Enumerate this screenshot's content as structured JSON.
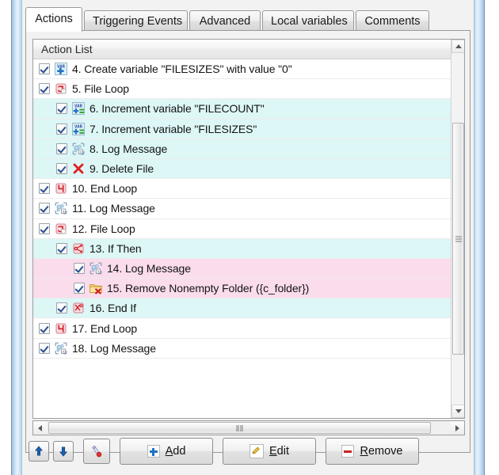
{
  "tabs": [
    {
      "label": "Actions",
      "active": true
    },
    {
      "label": "Triggering Events",
      "active": false
    },
    {
      "label": "Advanced",
      "active": false
    },
    {
      "label": "Local variables",
      "active": false
    },
    {
      "label": "Comments",
      "active": false
    }
  ],
  "list": {
    "header": "Action List",
    "rows": [
      {
        "text": "4. Create variable \"FILESIZES\" with value \"0\"",
        "indent": 0,
        "icon": "var-add-icon",
        "bg": "bg-white",
        "checked": true
      },
      {
        "text": "5. File Loop",
        "indent": 0,
        "icon": "loop-icon",
        "bg": "bg-white",
        "checked": true
      },
      {
        "text": "6. Increment variable \"FILECOUNT\"",
        "indent": 1,
        "icon": "var-increment-icon",
        "bg": "bg-cyan",
        "checked": true
      },
      {
        "text": "7. Increment variable \"FILESIZES\"",
        "indent": 1,
        "icon": "var-increment-icon",
        "bg": "bg-cyan",
        "checked": true
      },
      {
        "text": "8. Log Message",
        "indent": 1,
        "icon": "log-message-icon",
        "bg": "bg-cyan",
        "checked": true
      },
      {
        "text": "9. Delete File",
        "indent": 1,
        "icon": "delete-file-icon",
        "bg": "bg-cyan",
        "checked": true
      },
      {
        "text": "10. End Loop",
        "indent": 0,
        "icon": "end-loop-icon",
        "bg": "bg-white",
        "checked": true
      },
      {
        "text": "11. Log Message",
        "indent": 0,
        "icon": "log-message-icon",
        "bg": "bg-white",
        "checked": true
      },
      {
        "text": "12. File Loop",
        "indent": 0,
        "icon": "loop-icon",
        "bg": "bg-white",
        "checked": true
      },
      {
        "text": "13. If Then",
        "indent": 1,
        "icon": "if-then-icon",
        "bg": "bg-cyan",
        "checked": true
      },
      {
        "text": "14. Log Message",
        "indent": 2,
        "icon": "log-message-icon",
        "bg": "bg-pink",
        "checked": true
      },
      {
        "text": "15. Remove Nonempty Folder  ({c_folder})",
        "indent": 2,
        "icon": "remove-folder-icon",
        "bg": "bg-pink",
        "checked": true
      },
      {
        "text": "16. End If",
        "indent": 1,
        "icon": "end-if-icon",
        "bg": "bg-cyan",
        "checked": true
      },
      {
        "text": "17. End Loop",
        "indent": 0,
        "icon": "end-loop-icon",
        "bg": "bg-white",
        "checked": true
      },
      {
        "text": "18. Log Message",
        "indent": 0,
        "icon": "log-message-icon",
        "bg": "bg-white",
        "checked": true
      }
    ]
  },
  "toolbar": {
    "move_up_label": "",
    "move_down_label": "",
    "tool_label": "",
    "add_label": "Add",
    "add_mnemonic": "A",
    "edit_label": "Edit",
    "edit_mnemonic": "E",
    "remove_label": "Remove",
    "remove_mnemonic": "R"
  },
  "colors": {
    "row_cyan": "#ddf6f6",
    "row_pink": "#fadcec",
    "row_white": "#ffffff",
    "accent_blue": "#1f74c4",
    "accent_red": "#cc2222"
  }
}
